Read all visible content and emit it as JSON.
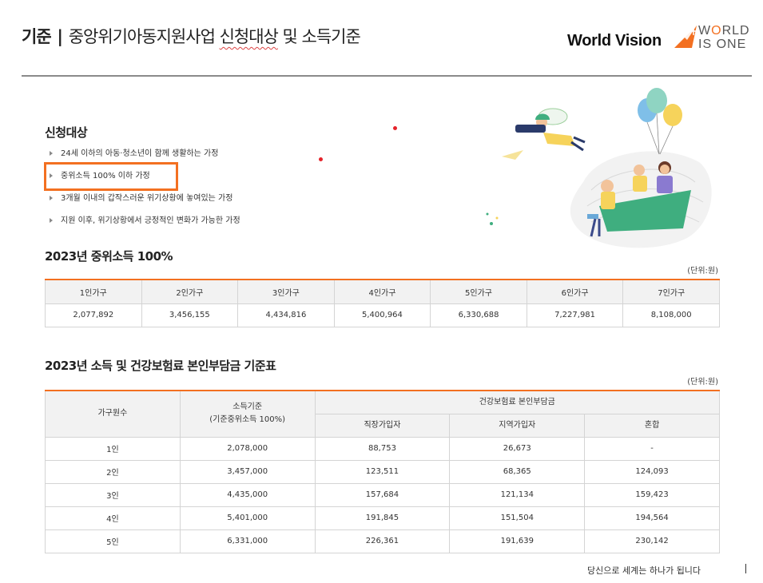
{
  "header": {
    "title_prefix": "기준",
    "title_sep": "|",
    "title_text": "중앙위기아동지원사업",
    "title_underlined": "신청대상",
    "title_suffix": "및 소득기준"
  },
  "logo": {
    "brand": "World Vision",
    "tagline_line1_a": "W",
    "tagline_line1_o": "O",
    "tagline_line1_b": "RLD",
    "tagline_line2": "IS ONE",
    "accent_color": "#f37021"
  },
  "eligibility": {
    "title": "신청대상",
    "items": [
      "24세 이하의 아동·청소년이 함께 생활하는 가정",
      "중위소득 100% 이하 가정",
      "3개월 이내의 갑작스러운 위기상황에 놓여있는 가정",
      "지원 이후, 위기상황에서 긍정적인 변화가 가능한 가정"
    ],
    "highlighted_index": 1
  },
  "median_income": {
    "title": "2023년 중위소득 100%",
    "unit": "(단위:원)",
    "headers": [
      "1인가구",
      "2인가구",
      "3인가구",
      "4인가구",
      "5인가구",
      "6인가구",
      "7인가구"
    ],
    "values": [
      "2,077,892",
      "3,456,155",
      "4,434,816",
      "5,400,964",
      "6,330,688",
      "7,227,981",
      "8,108,000"
    ]
  },
  "insurance_table": {
    "title": "2023년 소득 및 건강보험료 본인부담금 기준표",
    "unit": "(단위:원)",
    "col_household": "가구원수",
    "col_income_line1": "소득기준",
    "col_income_line2": "(기준중위소득 100%)",
    "col_premium_group": "건강보험료 본인부담금",
    "col_employee": "직장가입자",
    "col_regional": "지역가입자",
    "col_mixed": "혼합",
    "rows": [
      {
        "size": "1인",
        "income": "2,078,000",
        "employee": "88,753",
        "regional": "26,673",
        "mixed": "-"
      },
      {
        "size": "2인",
        "income": "3,457,000",
        "employee": "123,511",
        "regional": "68,365",
        "mixed": "124,093"
      },
      {
        "size": "3인",
        "income": "4,435,000",
        "employee": "157,684",
        "regional": "121,134",
        "mixed": "159,423"
      },
      {
        "size": "4인",
        "income": "5,401,000",
        "employee": "191,845",
        "regional": "151,504",
        "mixed": "194,564"
      },
      {
        "size": "5인",
        "income": "6,331,000",
        "employee": "226,361",
        "regional": "191,639",
        "mixed": "230,142"
      }
    ]
  },
  "footer": {
    "slogan": "당신으로 세계는 하나가 됩니다"
  }
}
